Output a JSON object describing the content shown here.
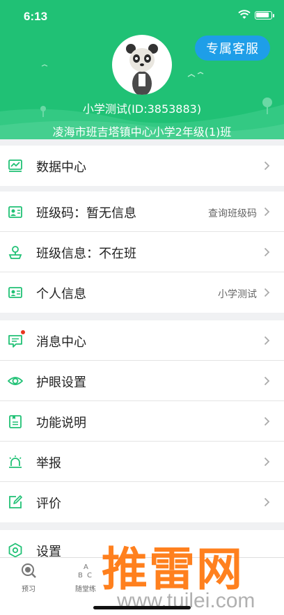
{
  "status_bar": {
    "time": "6:13"
  },
  "header": {
    "service_button": "专属客服",
    "username": "小学测试(ID:3853883)",
    "school": "凌海市班吉塔镇中心小学2年级(1)班"
  },
  "groups": [
    [
      {
        "icon": "chart-icon",
        "label": "数据中心",
        "value": ""
      }
    ],
    [
      {
        "icon": "class-code-icon",
        "label": "班级码：暂无信息",
        "value": "查询班级码"
      },
      {
        "icon": "class-info-icon",
        "label": "班级信息：不在班",
        "value": ""
      },
      {
        "icon": "id-card-icon",
        "label": "个人信息",
        "value": "小学测试"
      }
    ],
    [
      {
        "icon": "message-icon",
        "label": "消息中心",
        "value": ""
      },
      {
        "icon": "eye-icon",
        "label": "护眼设置",
        "value": ""
      },
      {
        "icon": "book-icon",
        "label": "功能说明",
        "value": ""
      },
      {
        "icon": "alarm-icon",
        "label": "举报",
        "value": ""
      },
      {
        "icon": "edit-icon",
        "label": "评价",
        "value": ""
      }
    ],
    [
      {
        "icon": "settings-icon",
        "label": "设置",
        "value": ""
      }
    ]
  ],
  "tabbar": [
    {
      "icon": "preview-icon",
      "label": "预习"
    },
    {
      "icon": "abc-icon",
      "label": "随堂练"
    }
  ],
  "watermark": {
    "big": "推雷网",
    "small": "www.tuilei.com"
  },
  "colors": {
    "brand": "#20c175",
    "service": "#1e9ee8",
    "badge": "#e8341f"
  }
}
